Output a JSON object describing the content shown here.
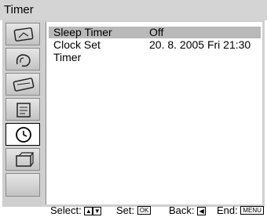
{
  "title": "Timer",
  "menu": {
    "rows": [
      {
        "label": "Sleep Timer",
        "value": "Off"
      },
      {
        "label": "Clock Set",
        "value": "20. 8. 2005 Fri 21:30"
      },
      {
        "label": "Timer",
        "value": ""
      }
    ]
  },
  "sidebar": {
    "icons": [
      {
        "name": "picture-icon"
      },
      {
        "name": "sound-icon"
      },
      {
        "name": "screen-icon"
      },
      {
        "name": "channel-icon"
      },
      {
        "name": "timer-clock-icon",
        "selected": true
      },
      {
        "name": "setup-icon"
      }
    ]
  },
  "footer": {
    "select_label": "Select:",
    "set_label": "Set:",
    "set_key": "OK",
    "back_label": "Back:",
    "end_label": "End:",
    "end_key": "MENU"
  },
  "colors": {
    "title_bar": "#d4d4d4",
    "sidebar_bg": "#cfcfcf",
    "selected_row": "#b9b9b9"
  }
}
